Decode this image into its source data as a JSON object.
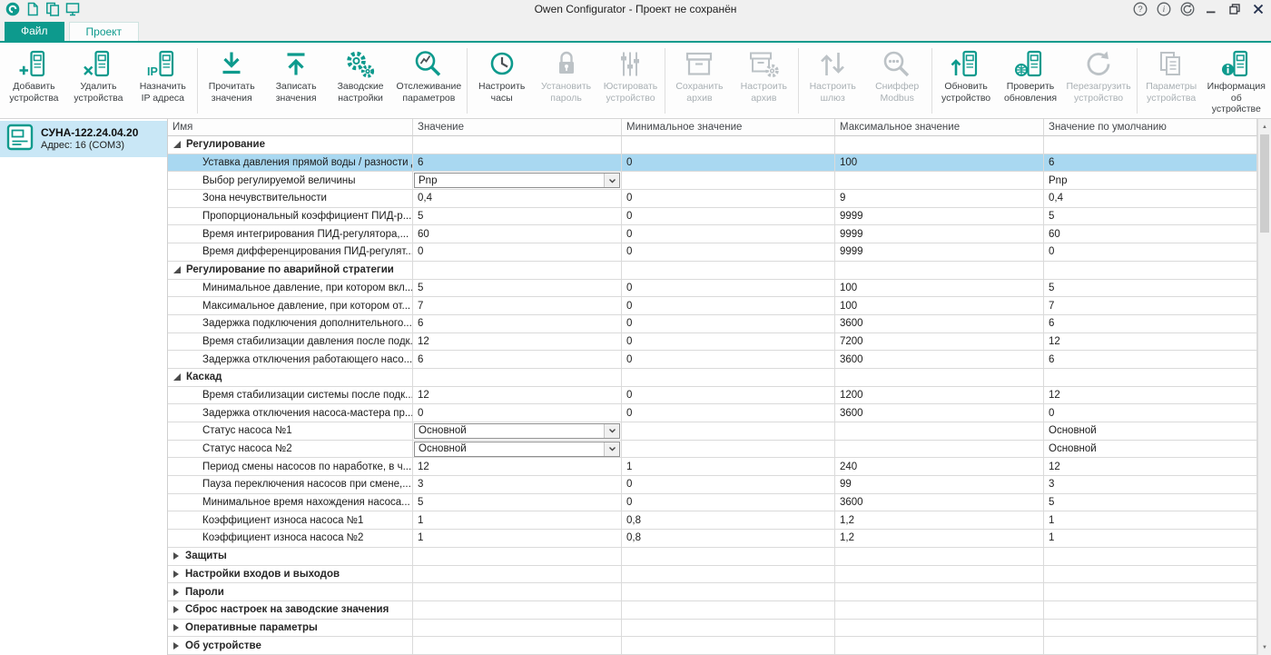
{
  "titlebar": {
    "title": "Owen Configurator - Проект не сохранён",
    "left_icons": [
      "app-logo",
      "new-project-icon",
      "open-project-icon",
      "save-project-icon"
    ],
    "right_icons": [
      "help-icon",
      "about-icon",
      "update-check-icon",
      "minimize-icon",
      "maximize-icon",
      "close-icon"
    ]
  },
  "tabs": [
    {
      "id": "file",
      "label": "Файл",
      "filled": true
    },
    {
      "id": "project",
      "label": "Проект",
      "filled": false
    }
  ],
  "toolbar_groups": [
    {
      "buttons": [
        {
          "label": "Добавить устройства",
          "icon": "add-device-icon",
          "enabled": true
        },
        {
          "label": "Удалить устройства",
          "icon": "remove-device-icon",
          "enabled": true
        },
        {
          "label": "Назначить IP адреса",
          "icon": "assign-ip-icon",
          "enabled": true
        }
      ]
    },
    {
      "buttons": [
        {
          "label": "Прочитать значения",
          "icon": "read-values-icon",
          "enabled": true
        },
        {
          "label": "Записать значения",
          "icon": "write-values-icon",
          "enabled": true
        },
        {
          "label": "Заводские настройки",
          "icon": "factory-settings-icon",
          "enabled": true
        },
        {
          "label": "Отслеживание параметров",
          "icon": "track-parameters-icon",
          "enabled": true
        }
      ]
    },
    {
      "buttons": [
        {
          "label": "Настроить часы",
          "icon": "clock-icon",
          "enabled": true
        },
        {
          "label": "Установить пароль",
          "icon": "lock-icon",
          "enabled": false
        },
        {
          "label": "Юстировать устройство",
          "icon": "calibrate-icon",
          "enabled": false
        }
      ]
    },
    {
      "buttons": [
        {
          "label": "Сохранить архив",
          "icon": "save-archive-icon",
          "enabled": false
        },
        {
          "label": "Настроить архив",
          "icon": "configure-archive-icon",
          "enabled": false
        }
      ]
    },
    {
      "buttons": [
        {
          "label": "Настроить шлюз",
          "icon": "gateway-icon",
          "enabled": false
        },
        {
          "label": "Сниффер Modbus",
          "icon": "modbus-sniffer-icon",
          "enabled": false
        }
      ]
    },
    {
      "buttons": [
        {
          "label": "Обновить устройство",
          "icon": "update-device-icon",
          "enabled": true
        },
        {
          "label": "Проверить обновления",
          "icon": "check-updates-icon",
          "enabled": true
        },
        {
          "label": "Перезагрузить устройство",
          "icon": "reboot-device-icon",
          "enabled": false
        }
      ]
    },
    {
      "buttons": [
        {
          "label": "Параметры устройства",
          "icon": "device-parameters-icon",
          "enabled": false
        },
        {
          "label": "Информация об устройстве",
          "icon": "device-info-icon",
          "enabled": true
        }
      ]
    }
  ],
  "sidebar": {
    "device_name": "СУНА-122.24.04.20",
    "device_address": "Адрес: 16 (COM3)"
  },
  "table": {
    "columns": [
      "Имя",
      "Значение",
      "Минимальное значение",
      "Максимальное значение",
      "Значение по умолчанию"
    ],
    "rows": [
      {
        "type": "group",
        "label": "Регулирование",
        "expanded": true
      },
      {
        "type": "param",
        "name": "Уставка давления прямой воды / разности д",
        "value": "6",
        "min": "0",
        "max": "100",
        "default": "6",
        "selected": true
      },
      {
        "type": "param",
        "name": "Выбор регулируемой величины",
        "value": "Pnp",
        "min": "",
        "max": "",
        "default": "Pnp",
        "editor": "dropdown"
      },
      {
        "type": "param",
        "name": "Зона нечувствительности",
        "value": "0,4",
        "min": "0",
        "max": "9",
        "default": "0,4"
      },
      {
        "type": "param",
        "name": "Пропорциональный коэффициент ПИД-р...",
        "value": "5",
        "min": "0",
        "max": "9999",
        "default": "5"
      },
      {
        "type": "param",
        "name": "Время интегрирования ПИД-регулятора,...",
        "value": "60",
        "min": "0",
        "max": "9999",
        "default": "60"
      },
      {
        "type": "param",
        "name": "Время дифференцирования ПИД-регулят...",
        "value": "0",
        "min": "0",
        "max": "9999",
        "default": "0"
      },
      {
        "type": "group",
        "label": "Регулирование по аварийной стратегии",
        "expanded": true
      },
      {
        "type": "param",
        "name": "Минимальное давление, при котором вкл...",
        "value": "5",
        "min": "0",
        "max": "100",
        "default": "5"
      },
      {
        "type": "param",
        "name": "Максимальное давление, при котором от...",
        "value": "7",
        "min": "0",
        "max": "100",
        "default": "7"
      },
      {
        "type": "param",
        "name": "Задержка подключения дополнительного...",
        "value": "6",
        "min": "0",
        "max": "3600",
        "default": "6"
      },
      {
        "type": "param",
        "name": "Время стабилизации давления после подк...",
        "value": "12",
        "min": "0",
        "max": "7200",
        "default": "12"
      },
      {
        "type": "param",
        "name": "Задержка отключения работающего насо...",
        "value": "6",
        "min": "0",
        "max": "3600",
        "default": "6"
      },
      {
        "type": "group",
        "label": "Каскад",
        "expanded": true
      },
      {
        "type": "param",
        "name": "Время стабилизации системы после подк...",
        "value": "12",
        "min": "0",
        "max": "1200",
        "default": "12"
      },
      {
        "type": "param",
        "name": "Задержка отключения насоса-мастера пр...",
        "value": "0",
        "min": "0",
        "max": "3600",
        "default": "0"
      },
      {
        "type": "param",
        "name": "Статус насоса №1",
        "value": "Основной",
        "min": "",
        "max": "",
        "default": "Основной",
        "editor": "dropdown"
      },
      {
        "type": "param",
        "name": "Статус насоса №2",
        "value": "Основной",
        "min": "",
        "max": "",
        "default": "Основной",
        "editor": "dropdown"
      },
      {
        "type": "param",
        "name": "Период смены насосов по наработке, в ч...",
        "value": "12",
        "min": "1",
        "max": "240",
        "default": "12"
      },
      {
        "type": "param",
        "name": "Пауза переключения насосов при смене,...",
        "value": "3",
        "min": "0",
        "max": "99",
        "default": "3"
      },
      {
        "type": "param",
        "name": "Минимальное время нахождения насоса...",
        "value": "5",
        "min": "0",
        "max": "3600",
        "default": "5"
      },
      {
        "type": "param",
        "name": "Коэффициент износа насоса №1",
        "value": "1",
        "min": "0,8",
        "max": "1,2",
        "default": "1"
      },
      {
        "type": "param",
        "name": "Коэффициент износа насоса №2",
        "value": "1",
        "min": "0,8",
        "max": "1,2",
        "default": "1"
      },
      {
        "type": "group",
        "label": "Защиты",
        "expanded": false
      },
      {
        "type": "group",
        "label": "Настройки входов и выходов",
        "expanded": false
      },
      {
        "type": "group",
        "label": "Пароли",
        "expanded": false
      },
      {
        "type": "group",
        "label": "Сброс настроек на заводские значения",
        "expanded": false
      },
      {
        "type": "group",
        "label": "Оперативные параметры",
        "expanded": false
      },
      {
        "type": "group",
        "label": "Об устройстве",
        "expanded": false
      }
    ]
  },
  "scrollbar": {
    "up": "▲",
    "down": "▼"
  },
  "colors": {
    "accent": "#0d9a8d",
    "selection_row": "#a9d8f1",
    "sidebar_selection": "#c9e7f6",
    "disabled_icon": "#bcc2c6"
  }
}
